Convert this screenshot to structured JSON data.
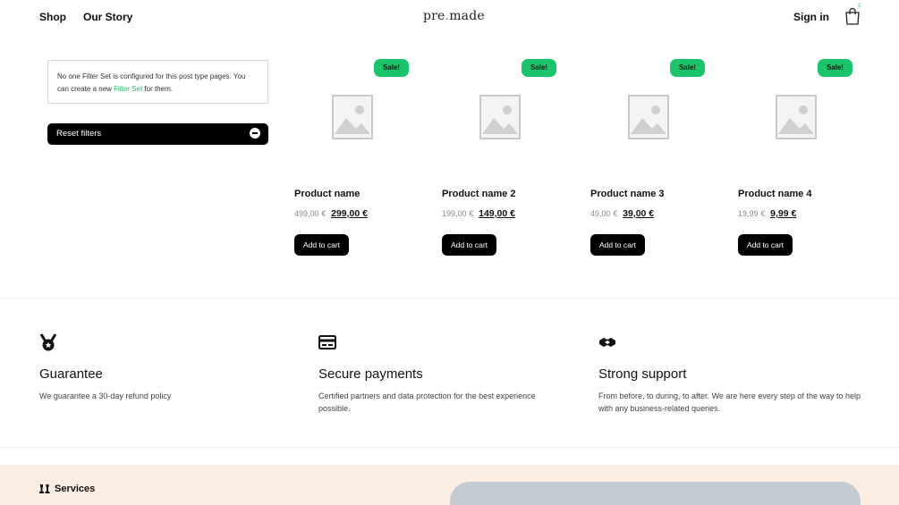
{
  "header": {
    "nav": [
      {
        "label": "Shop"
      },
      {
        "label": "Our Story"
      }
    ],
    "logo_prefix": "pre",
    "logo_dot": ".",
    "logo_suffix": "made",
    "sign_in": "Sign in",
    "cart_count": "2"
  },
  "filters": {
    "notice_prefix": "No one Filter Set is configured for this post type pages. You can create a new ",
    "notice_link": "Filter Set",
    "notice_suffix": " for them.",
    "reset_label": "Reset filters"
  },
  "products": [
    {
      "badge": "Sale!",
      "name": "Product name",
      "old_price": "499,00",
      "currency": "€",
      "price": "299,00 €",
      "button": "Add to cart"
    },
    {
      "badge": "Sale!",
      "name": "Product name 2",
      "old_price": "199,00",
      "currency": "€",
      "price": "149,00 €",
      "button": "Add to cart"
    },
    {
      "badge": "Sale!",
      "name": "Product name 3",
      "old_price": "49,00",
      "currency": "€",
      "price": "39,00 €",
      "button": "Add to cart"
    },
    {
      "badge": "Sale!",
      "name": "Product name 4",
      "old_price": "19,99",
      "currency": "€",
      "price": "9,99 €",
      "button": "Add to cart"
    }
  ],
  "features": [
    {
      "icon": "medal-icon",
      "title": "Guarantee",
      "description": "We guarantee a 30-day refund policy"
    },
    {
      "icon": "credit-card-icon",
      "title": "Secure payments",
      "description": "Certified partners and data protection for the best experience possible."
    },
    {
      "icon": "handshake-icon",
      "title": "Strong support",
      "description": "From before, to during, to after. We are here every step of the way to help with any business-related queries."
    }
  ],
  "services": {
    "icon": "chess-icon",
    "title": "Services"
  },
  "colors": {
    "accent": "#1fbf6b",
    "sale_badge": "#19c46b",
    "band": "#fcede2",
    "card": "#c5cbd2"
  }
}
